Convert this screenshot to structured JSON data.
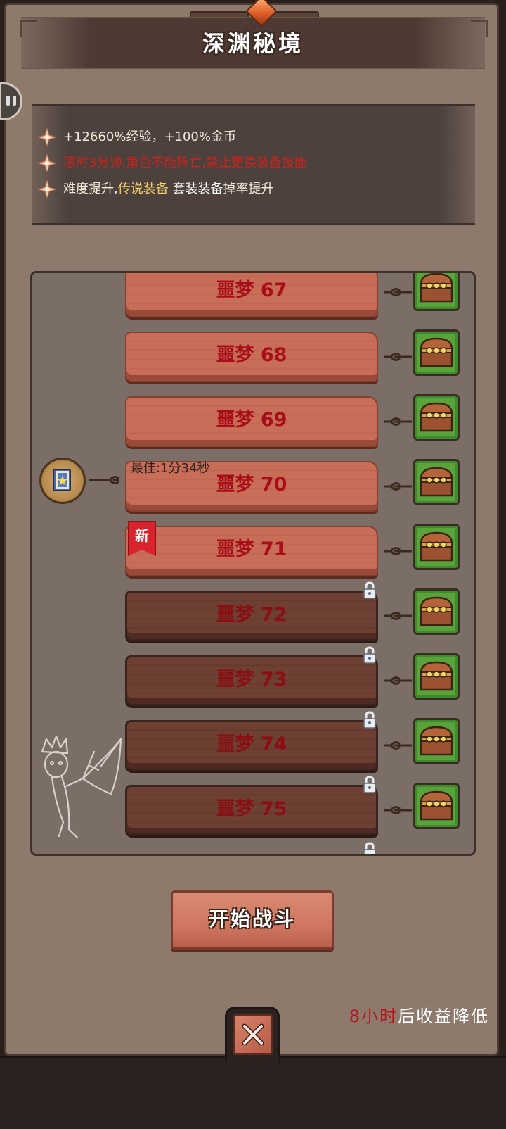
{
  "header": {
    "title": "深渊秘境"
  },
  "bonuses": [
    {
      "text": "+12660%经验，+100%金币",
      "color": "#f3ead8"
    },
    {
      "text": "限时3分钟,角色不能阵亡,禁止更换装备技能",
      "color": "#c9231c"
    },
    {
      "text_parts": [
        "难度提升,",
        "传说装备",
        " 套装装备",
        "掉率提升"
      ],
      "colors": [
        "#f3ead8",
        "#f2d26b",
        "#ffffff",
        "#f3ead8"
      ]
    }
  ],
  "levels": [
    {
      "label": "噩梦 67",
      "locked": false
    },
    {
      "label": "噩梦 68",
      "locked": false
    },
    {
      "label": "噩梦 69",
      "locked": false
    },
    {
      "label": "噩梦 70",
      "locked": false,
      "best_time": "最佳:1分34秒"
    },
    {
      "label": "噩梦 71",
      "locked": false,
      "badge": "新"
    },
    {
      "label": "噩梦 72",
      "locked": true
    },
    {
      "label": "噩梦 73",
      "locked": true
    },
    {
      "label": "噩梦 74",
      "locked": true
    },
    {
      "label": "噩梦 75",
      "locked": true
    }
  ],
  "start_button": {
    "label": "开始战斗"
  },
  "timer_note": {
    "hours": "8小时",
    "suffix": "后收益降低"
  },
  "icons": {
    "bonus": "sparkle-star-icon",
    "reward": "treasure-chest-icon",
    "lock": "lock-icon",
    "close": "close-x-icon",
    "side": "pause-icon",
    "record": "book-medal-icon"
  },
  "colors": {
    "panel_bg": "#8d7a6d",
    "plank_open": "#c46a55",
    "plank_locked": "#6a3c31",
    "chest_bg": "#5aa33a",
    "level_text": "#a80e18",
    "accent_red": "#b2171e"
  }
}
